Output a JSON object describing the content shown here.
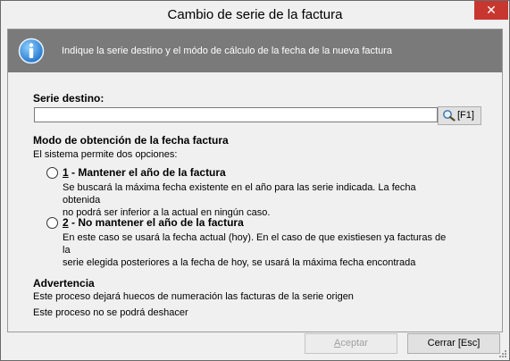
{
  "window": {
    "title": "Cambio de serie de la factura",
    "close_glyph": "✕"
  },
  "banner": {
    "icon": "info-icon",
    "message": "Indique la serie destino y el módo de cálculo de la fecha de la nueva factura"
  },
  "serie": {
    "label": "Serie destino:",
    "value": "",
    "placeholder": "",
    "search_icon": "magnifier-icon",
    "search_key": "[F1]"
  },
  "modo": {
    "title": "Modo de obtención de la fecha factura",
    "subtitle": "El sistema permite dos opciones:",
    "options": [
      {
        "number": "1",
        "label": " - Mantener el año de la factura",
        "line1": "Se buscará la máxima fecha existente en el año para las serie indicada. La fecha obtenida",
        "line2": "no podrá ser inferior a la actual en ningún caso."
      },
      {
        "number": "2",
        "label": " - No mantener el año de la factura",
        "line1": "En este caso se usará la fecha actual (hoy). En el caso de que existiesen ya facturas de la",
        "line2": "serie elegida posteriores a la fecha de hoy, se usará la máxima fecha encontrada"
      }
    ]
  },
  "advertencia": {
    "title": "Advertencia",
    "line1": "Este proceso dejará huecos de numeración las facturas de la serie origen",
    "line2": "Este proceso no se podrá deshacer"
  },
  "buttons": {
    "accept_hotkey": "A",
    "accept_rest": "ceptar",
    "close": "Cerrar  [Esc]"
  }
}
